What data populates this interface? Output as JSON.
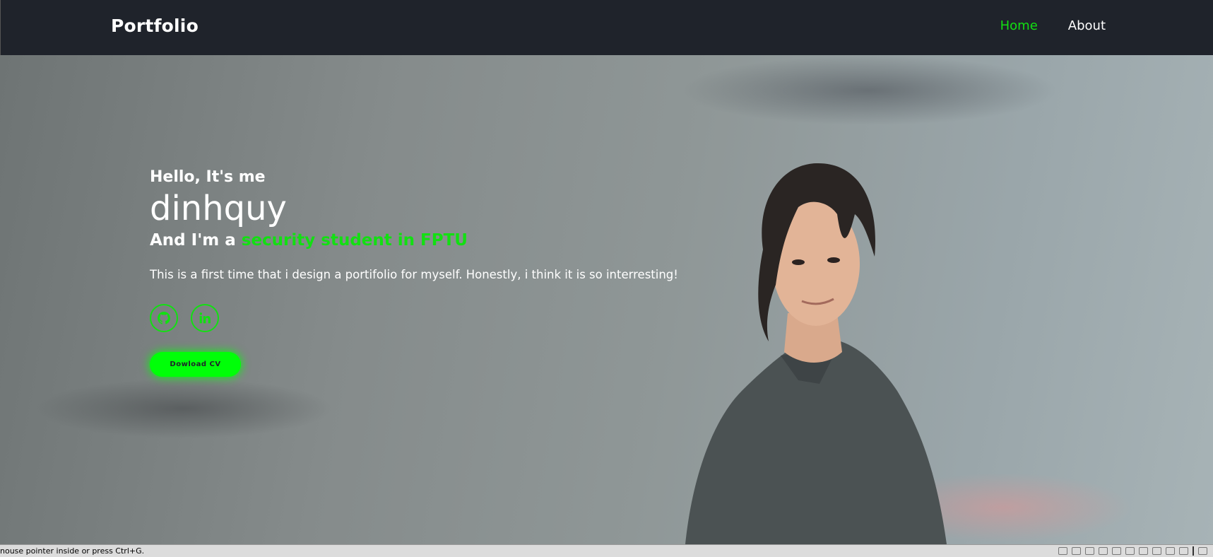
{
  "navbar": {
    "logo": "Portfolio",
    "links": [
      {
        "label": "Home",
        "active": true
      },
      {
        "label": "About",
        "active": false
      }
    ]
  },
  "hero": {
    "greeting": "Hello, It's me",
    "name": "dinhquy",
    "role_prefix": "And I'm a ",
    "role_highlight": "security student in FPTU",
    "description": "This is a first time that i design a portifolio for myself. Honestly, i think it is so interresting!",
    "socials": [
      {
        "icon": "github-icon"
      },
      {
        "icon": "linkedin-icon"
      }
    ],
    "cv_button": "Dowload CV"
  },
  "status_bar": {
    "text": "nouse pointer inside or press Ctrl+G."
  },
  "colors": {
    "accent": "#12e012",
    "navbar_bg": "#1f232b",
    "button_bg": "#00ff08"
  }
}
